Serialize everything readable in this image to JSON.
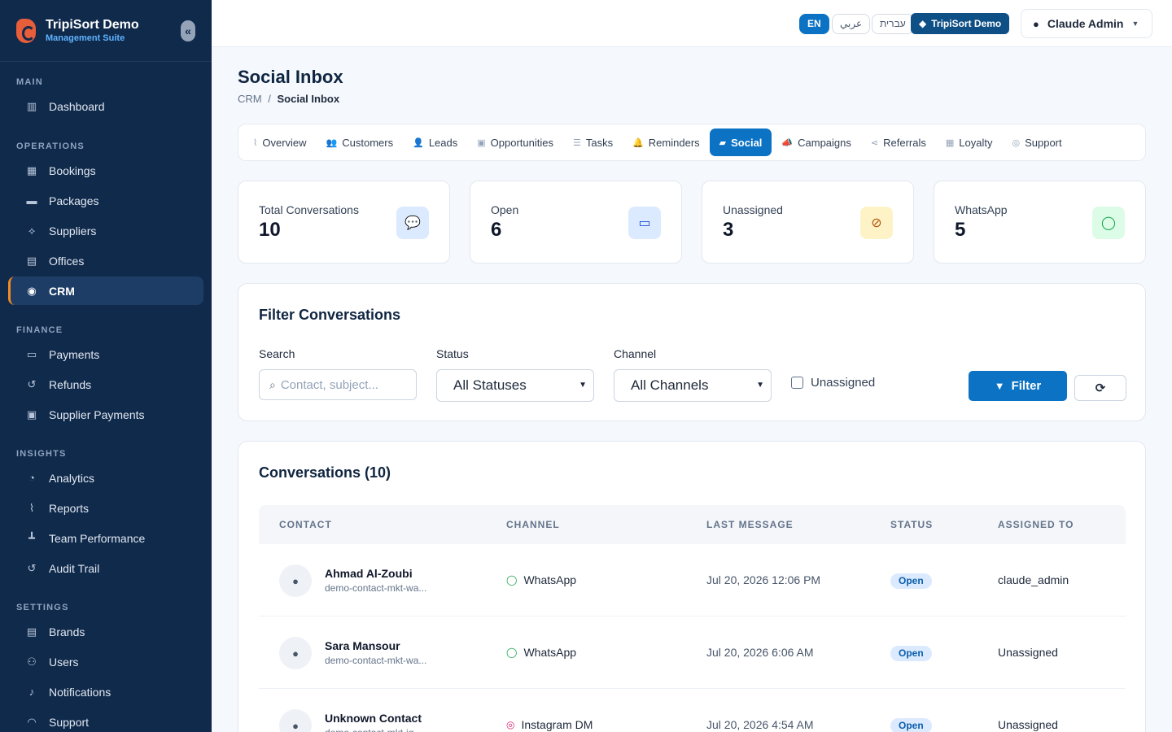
{
  "brand": {
    "name": "TripiSort Demo",
    "subtitle": "Management Suite"
  },
  "sidebar": {
    "sections": [
      {
        "heading": "MAIN",
        "items": [
          {
            "label": "Dashboard",
            "icon": "dashboard-icon"
          }
        ]
      },
      {
        "heading": "OPERATIONS",
        "items": [
          {
            "label": "Bookings",
            "icon": "calendar-icon"
          },
          {
            "label": "Packages",
            "icon": "briefcase-icon"
          },
          {
            "label": "Suppliers",
            "icon": "handshake-icon"
          },
          {
            "label": "Offices",
            "icon": "building-icon"
          },
          {
            "label": "CRM",
            "icon": "bullseye-icon",
            "active": true
          }
        ]
      },
      {
        "heading": "FINANCE",
        "items": [
          {
            "label": "Payments",
            "icon": "credit-card-icon"
          },
          {
            "label": "Refunds",
            "icon": "undo-icon"
          },
          {
            "label": "Supplier Payments",
            "icon": "money-icon"
          }
        ]
      },
      {
        "heading": "INSIGHTS",
        "items": [
          {
            "label": "Analytics",
            "icon": "pie-chart-icon"
          },
          {
            "label": "Reports",
            "icon": "line-chart-icon"
          },
          {
            "label": "Team Performance",
            "icon": "org-chart-icon"
          },
          {
            "label": "Audit Trail",
            "icon": "history-icon"
          }
        ]
      },
      {
        "heading": "SETTINGS",
        "items": [
          {
            "label": "Brands",
            "icon": "building-icon"
          },
          {
            "label": "Users",
            "icon": "users-icon"
          },
          {
            "label": "Notifications",
            "icon": "bell-icon"
          },
          {
            "label": "Support",
            "icon": "headset-icon"
          }
        ]
      }
    ]
  },
  "topbar": {
    "languages": [
      "EN",
      "عربي",
      "עברית"
    ],
    "brand_pill": "TripiSort Demo",
    "user": "Claude Admin"
  },
  "page": {
    "title": "Social Inbox",
    "breadcrumb_parent": "CRM",
    "breadcrumb_sep": "/",
    "breadcrumb_current": "Social Inbox"
  },
  "tabs": [
    {
      "label": "Overview",
      "glyph": "⌇"
    },
    {
      "label": "Customers",
      "glyph": "👥"
    },
    {
      "label": "Leads",
      "glyph": "👤"
    },
    {
      "label": "Opportunities",
      "glyph": "▣"
    },
    {
      "label": "Tasks",
      "glyph": "☰"
    },
    {
      "label": "Reminders",
      "glyph": "🔔"
    },
    {
      "label": "Social",
      "glyph": "▰",
      "active": true
    },
    {
      "label": "Campaigns",
      "glyph": "📣"
    },
    {
      "label": "Referrals",
      "glyph": "⋖"
    },
    {
      "label": "Loyalty",
      "glyph": "▦"
    },
    {
      "label": "Support",
      "glyph": "◎"
    }
  ],
  "stats": [
    {
      "label": "Total Conversations",
      "value": "10",
      "icon": "comments-icon",
      "bg": "#dbeafe",
      "fg": "#1d4ed8",
      "glyph": "💬"
    },
    {
      "label": "Open",
      "value": "6",
      "icon": "inbox-icon",
      "bg": "#dbeafe",
      "fg": "#1d4ed8",
      "glyph": "▭"
    },
    {
      "label": "Unassigned",
      "value": "3",
      "icon": "user-slash-icon",
      "bg": "#fef3c7",
      "fg": "#b45309",
      "glyph": "⊘"
    },
    {
      "label": "WhatsApp",
      "value": "5",
      "icon": "whatsapp-icon",
      "bg": "#dcfce7",
      "fg": "#16a34a",
      "glyph": "◯"
    }
  ],
  "filter": {
    "title": "Filter Conversations",
    "search_label": "Search",
    "search_placeholder": "Contact, subject...",
    "status_label": "Status",
    "status_value": "All Statuses",
    "channel_label": "Channel",
    "channel_value": "All Channels",
    "unassigned_label": "Unassigned",
    "filter_button": "Filter"
  },
  "conversations": {
    "title": "Conversations (10)",
    "columns": [
      "CONTACT",
      "CHANNEL",
      "LAST MESSAGE",
      "STATUS",
      "ASSIGNED TO"
    ],
    "rows": [
      {
        "name": "Ahmad Al-Zoubi",
        "sub": "demo-contact-mkt-wa...",
        "channel": "WhatsApp",
        "channel_color": "#16a34a",
        "channel_glyph": "◯",
        "date": "Jul 20, 2026 12:06 PM",
        "status": "Open",
        "assigned": "claude_admin"
      },
      {
        "name": "Sara Mansour",
        "sub": "demo-contact-mkt-wa...",
        "channel": "WhatsApp",
        "channel_color": "#16a34a",
        "channel_glyph": "◯",
        "date": "Jul 20, 2026 6:06 AM",
        "status": "Open",
        "assigned": "Unassigned"
      },
      {
        "name": "Unknown Contact",
        "sub": "demo-contact-mkt-ig...",
        "channel": "Instagram DM",
        "channel_color": "#db2777",
        "channel_glyph": "◎",
        "date": "Jul 20, 2026 4:54 AM",
        "status": "Open",
        "assigned": "Unassigned"
      }
    ]
  }
}
